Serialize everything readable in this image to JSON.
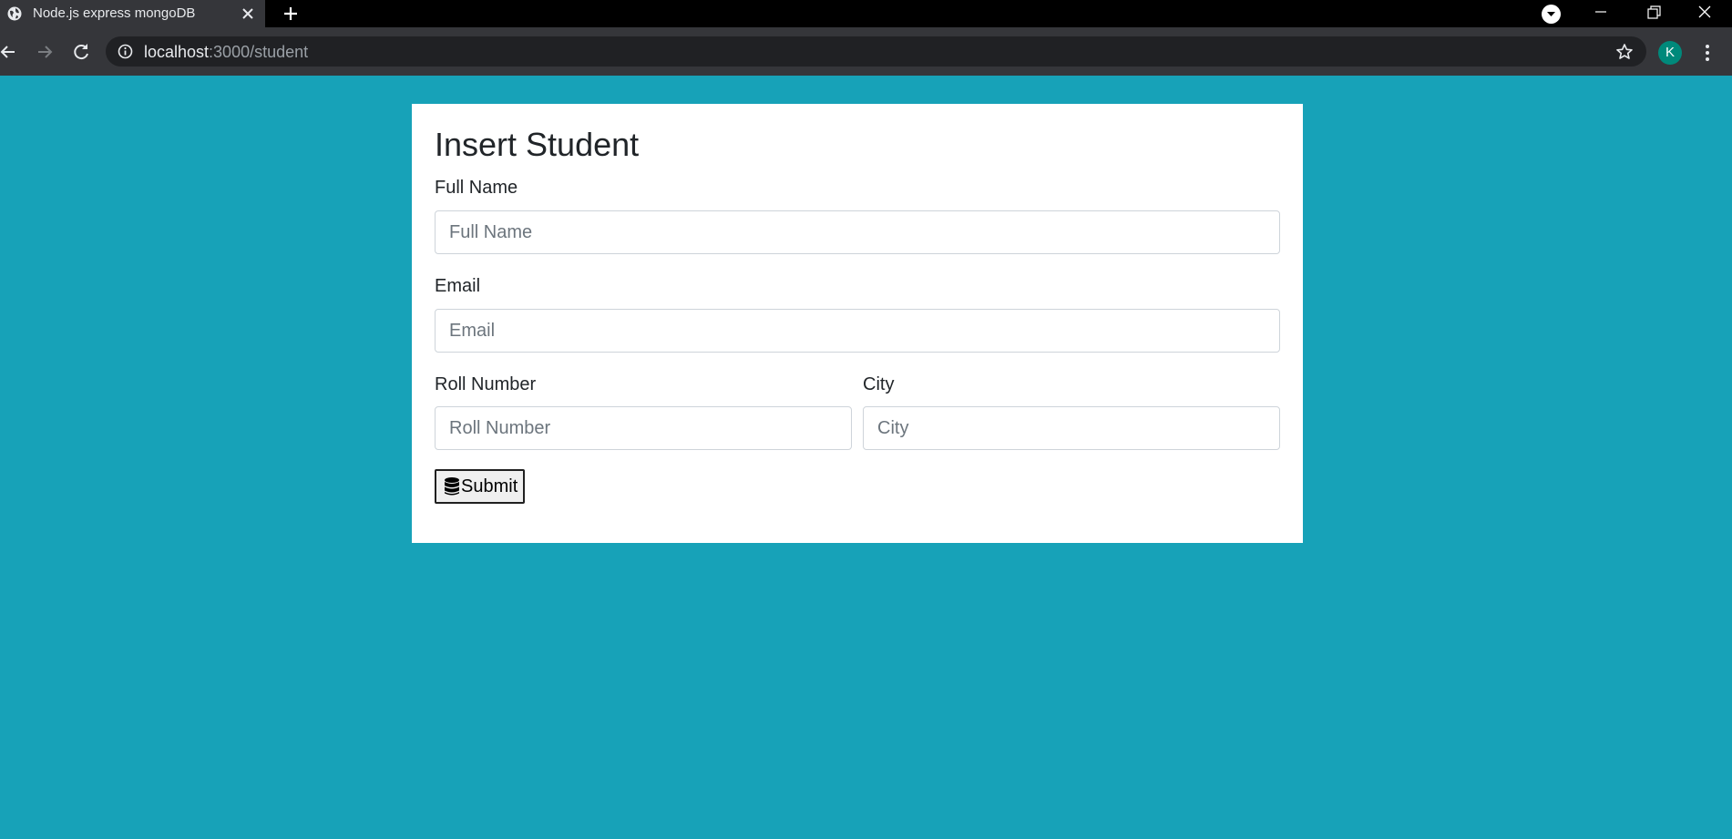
{
  "browser": {
    "tab_title": "Node.js express mongoDB",
    "url_host": "localhost",
    "url_path": ":3000/student",
    "profile_initial": "K"
  },
  "form": {
    "heading": "Insert Student",
    "full_name": {
      "label": "Full Name",
      "placeholder": "Full Name",
      "value": ""
    },
    "email": {
      "label": "Email",
      "placeholder": "Email",
      "value": ""
    },
    "roll_number": {
      "label": "Roll Number",
      "placeholder": "Roll Number",
      "value": ""
    },
    "city": {
      "label": "City",
      "placeholder": "City",
      "value": ""
    },
    "submit_label": "Submit",
    "submit_icon": "database-icon"
  },
  "colors": {
    "page_background": "#17a2b8",
    "card_background": "#ffffff",
    "avatar": "#00897b"
  }
}
